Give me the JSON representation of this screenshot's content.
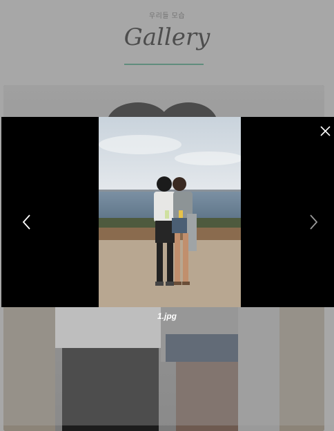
{
  "header": {
    "subtitle": "우리들 모습",
    "title": "Gallery"
  },
  "lightbox": {
    "caption": "1.jpg",
    "close_icon": "close-icon",
    "prev_icon": "chevron-left-icon",
    "next_icon": "chevron-right-icon"
  },
  "colors": {
    "page_background": "#a6a6a6",
    "underline_accent": "#3a7f66",
    "lightbox_background": "#000000"
  }
}
